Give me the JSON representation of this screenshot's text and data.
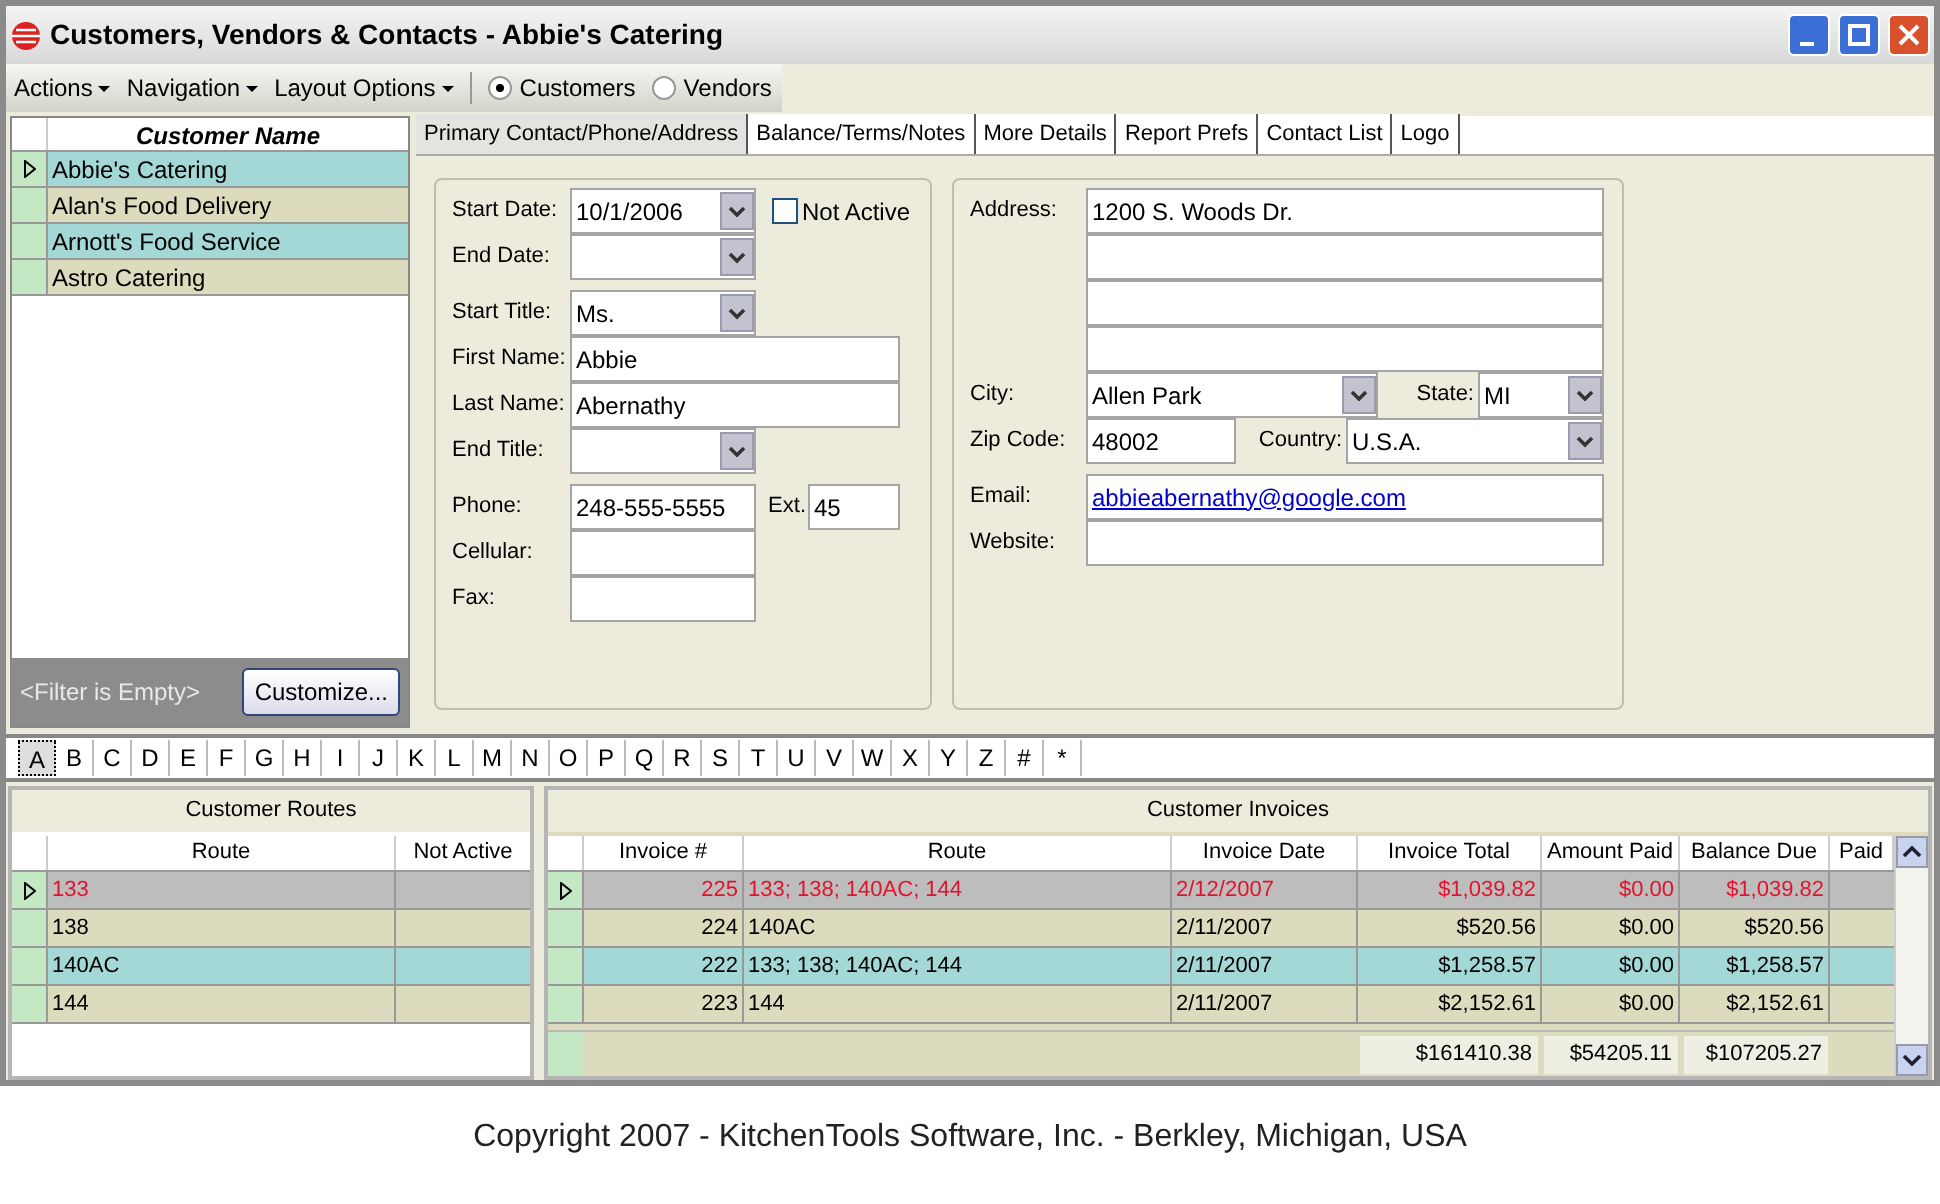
{
  "window": {
    "title": "Customers, Vendors & Contacts - Abbie's Catering"
  },
  "toolbar": {
    "menus": [
      "Actions",
      "Navigation",
      "Layout Options"
    ],
    "radios": [
      {
        "label": "Customers",
        "selected": true
      },
      {
        "label": "Vendors",
        "selected": false
      }
    ]
  },
  "customer_list": {
    "column": "Customer Name",
    "rows": [
      {
        "name": "Abbie's Catering",
        "current": true
      },
      {
        "name": "Alan's Food Delivery",
        "current": false
      },
      {
        "name": "Arnott's Food Service",
        "current": false
      },
      {
        "name": "Astro Catering",
        "current": false
      }
    ],
    "filter": "<Filter is Empty>",
    "customize_button": "Customize..."
  },
  "tabs": [
    {
      "label": "Primary Contact/Phone/Address",
      "selected": true
    },
    {
      "label": "Balance/Terms/Notes",
      "selected": false
    },
    {
      "label": "More Details",
      "selected": false
    },
    {
      "label": "Report Prefs",
      "selected": false
    },
    {
      "label": "Contact List",
      "selected": false
    },
    {
      "label": "Logo",
      "selected": false
    }
  ],
  "contact": {
    "start_date": {
      "label": "Start Date:",
      "value": "10/1/2006"
    },
    "not_active": {
      "label": "Not Active",
      "checked": false
    },
    "end_date": {
      "label": "End Date:"
    },
    "start_title": {
      "label": "Start Title:",
      "value": "Ms."
    },
    "first_name": {
      "label": "First Name:",
      "value": "Abbie"
    },
    "last_name": {
      "label": "Last Name:",
      "value": "Abernathy"
    },
    "end_title": {
      "label": "End Title:"
    },
    "phone": {
      "label": "Phone:",
      "value": "248-555-5555"
    },
    "ext": {
      "label": "Ext.",
      "value": "45"
    },
    "cellular": {
      "label": "Cellular:"
    },
    "fax": {
      "label": "Fax:"
    },
    "address": {
      "label": "Address:",
      "value": "1200 S. Woods Dr."
    },
    "city": {
      "label": "City:",
      "value": "Allen Park"
    },
    "state": {
      "label": "State:",
      "value": "MI"
    },
    "zip": {
      "label": "Zip Code:",
      "value": "48002"
    },
    "country": {
      "label": "Country:",
      "value": "U.S.A."
    },
    "email": {
      "label": "Email:",
      "value": "abbieabernathy@google.com"
    },
    "website": {
      "label": "Website:"
    }
  },
  "alphabet": [
    {
      "label": "A",
      "selected": true
    },
    {
      "label": "B",
      "selected": false
    },
    {
      "label": "C",
      "selected": false
    },
    {
      "label": "D",
      "selected": false
    },
    {
      "label": "E",
      "selected": false
    },
    {
      "label": "F",
      "selected": false
    },
    {
      "label": "G",
      "selected": false
    },
    {
      "label": "H",
      "selected": false
    },
    {
      "label": "I",
      "selected": false
    },
    {
      "label": "J",
      "selected": false
    },
    {
      "label": "K",
      "selected": false
    },
    {
      "label": "L",
      "selected": false
    },
    {
      "label": "M",
      "selected": false
    },
    {
      "label": "N",
      "selected": false
    },
    {
      "label": "O",
      "selected": false
    },
    {
      "label": "P",
      "selected": false
    },
    {
      "label": "Q",
      "selected": false
    },
    {
      "label": "R",
      "selected": false
    },
    {
      "label": "S",
      "selected": false
    },
    {
      "label": "T",
      "selected": false
    },
    {
      "label": "U",
      "selected": false
    },
    {
      "label": "V",
      "selected": false
    },
    {
      "label": "W",
      "selected": false
    },
    {
      "label": "X",
      "selected": false
    },
    {
      "label": "Y",
      "selected": false
    },
    {
      "label": "Z",
      "selected": false
    },
    {
      "label": "#",
      "selected": false
    },
    {
      "label": "*",
      "selected": false
    }
  ],
  "routes": {
    "title": "Customer Routes",
    "columns": [
      "Route",
      "Not Active"
    ],
    "rows": [
      {
        "route": "133",
        "current": true
      },
      {
        "route": "138",
        "current": false
      },
      {
        "route": "140AC",
        "current": false
      },
      {
        "route": "144",
        "current": false
      }
    ]
  },
  "invoices": {
    "title": "Customer Invoices",
    "columns": [
      "Invoice #",
      "Route",
      "Invoice Date",
      "Invoice Total",
      "Amount Paid",
      "Balance Due",
      "Paid"
    ],
    "rows": [
      {
        "cells": [
          "225",
          "133; 138; 140AC; 144",
          "2/12/2007",
          "$1,039.82",
          "$0.00",
          "$1,039.82"
        ],
        "current": true
      },
      {
        "cells": [
          "224",
          "140AC",
          "2/11/2007",
          "$520.56",
          "$0.00",
          "$520.56"
        ],
        "current": false
      },
      {
        "cells": [
          "222",
          "133; 138; 140AC; 144",
          "2/11/2007",
          "$1,258.57",
          "$0.00",
          "$1,258.57"
        ],
        "current": false
      },
      {
        "cells": [
          "223",
          "144",
          "2/11/2007",
          "$2,152.61",
          "$0.00",
          "$2,152.61"
        ],
        "current": false
      }
    ],
    "totals": [
      "$161410.38",
      "$54205.11",
      "$107205.27"
    ]
  },
  "copyright": "Copyright 2007 - KitchenTools Software, Inc. - Berkley, Michigan, USA"
}
